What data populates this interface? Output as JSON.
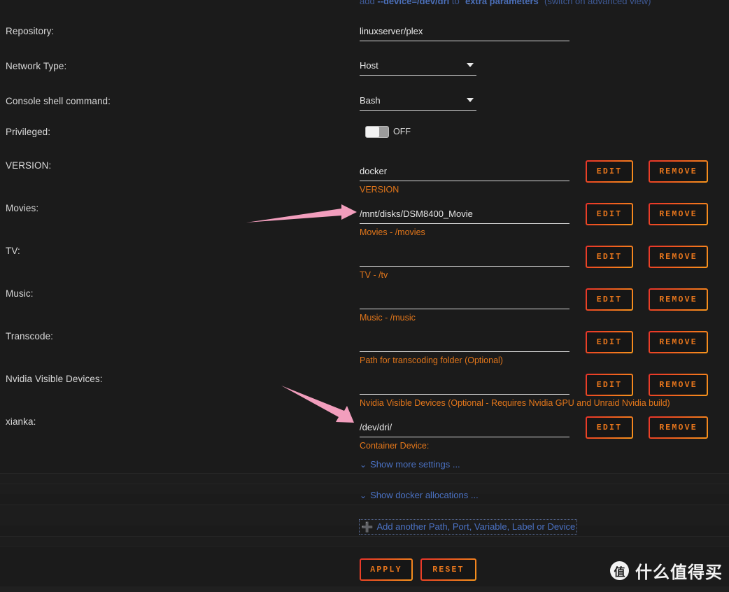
{
  "top_note": {
    "prefix": "add ",
    "code": "--device=/dev/dri",
    "mid": " to \"",
    "strong": "extra parameters",
    "suffix": "\" (switch on advanced view)"
  },
  "fields": {
    "repository": {
      "label": "Repository:",
      "value": "linuxserver/plex"
    },
    "network_type": {
      "label": "Network Type:",
      "value": "Host"
    },
    "console_shell": {
      "label": "Console shell command:",
      "value": "Bash"
    },
    "privileged": {
      "label": "Privileged:",
      "state": "OFF"
    }
  },
  "rows": [
    {
      "label": "VERSION:",
      "value": "docker",
      "hint": "VERSION"
    },
    {
      "label": "Movies:",
      "value": "/mnt/disks/DSM8400_Movie",
      "hint": "Movies - /movies"
    },
    {
      "label": "TV:",
      "value": "",
      "hint": "TV - /tv"
    },
    {
      "label": "Music:",
      "value": "",
      "hint": "Music - /music"
    },
    {
      "label": "Transcode:",
      "value": "",
      "hint": "Path for transcoding folder (Optional)"
    },
    {
      "label": "Nvidia Visible Devices:",
      "value": "",
      "hint": "Nvidia Visible Devices (Optional - Requires Nvidia GPU and Unraid Nvidia build)"
    },
    {
      "label": "xianka:",
      "value": "/dev/dri/",
      "hint": "Container Device:"
    }
  ],
  "row_buttons": {
    "edit": "EDIT",
    "remove": "REMOVE"
  },
  "links": {
    "show_more": "Show more settings ...",
    "show_allocations": "Show docker allocations ...",
    "add_another": "Add another Path, Port, Variable, Label or Device"
  },
  "actions": {
    "apply": "APPLY",
    "reset": "RESET"
  },
  "watermark": {
    "badge": "值",
    "text": "什么值得买"
  },
  "colors": {
    "background": "#1b1b1b",
    "hint": "#e2761b",
    "link": "#4b72c4",
    "button_border_start": "#e8332a",
    "button_border_end": "#f7951d",
    "arrow": "#f29ebd"
  }
}
